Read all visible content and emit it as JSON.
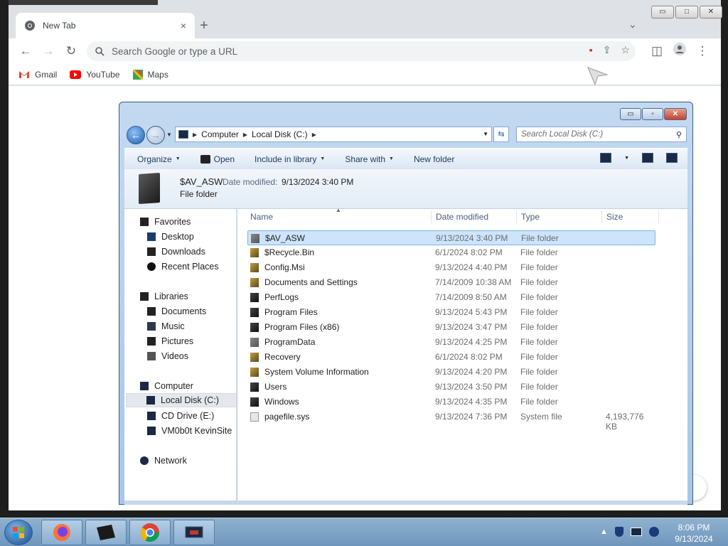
{
  "browser": {
    "tab_title": "New Tab",
    "tab_close": "×",
    "new_tab": "+",
    "omnibox_placeholder": "Search Google or type a URL",
    "bookmarks": [
      {
        "label": "Gmail",
        "color": "#ea4335"
      },
      {
        "label": "YouTube",
        "color": "#ff0000"
      },
      {
        "label": "Maps",
        "color": "#34a853"
      }
    ],
    "win_controls": [
      "▭",
      "□",
      "✕"
    ]
  },
  "explorer": {
    "controls": [
      "▭",
      "▫",
      "✕"
    ],
    "breadcrumb": [
      "Computer",
      "Local Disk (C:)"
    ],
    "search_placeholder": "Search Local Disk (C:)",
    "commands": [
      {
        "label": "Organize",
        "arrow": "▼"
      },
      {
        "label": "Open",
        "arrow": ""
      },
      {
        "label": "Include in library",
        "arrow": "▼"
      },
      {
        "label": "Share with",
        "arrow": "▼"
      },
      {
        "label": "New folder",
        "arrow": ""
      }
    ],
    "details": {
      "name": "$AV_ASW",
      "date_label": "Date modified:",
      "date_value": "9/13/2024 3:40 PM",
      "kind": "File folder"
    },
    "nav": {
      "favorites": "Favorites",
      "desktop": "Desktop",
      "downloads": "Downloads",
      "recent": "Recent Places",
      "libraries": "Libraries",
      "documents": "Documents",
      "music": "Music",
      "pictures": "Pictures",
      "videos": "Videos",
      "computer": "Computer",
      "local_disk": "Local Disk (C:)",
      "cd_drive": "CD Drive (E:)",
      "share": "VM0b0t KevinSite",
      "network": "Network"
    },
    "columns": {
      "name": "Name",
      "date": "Date modified",
      "type": "Type",
      "size": "Size"
    },
    "rows": [
      {
        "name": "$AV_ASW",
        "date": "9/13/2024 3:40 PM",
        "type": "File folder",
        "size": "",
        "icon": "fold-light",
        "selected": true
      },
      {
        "name": "$Recycle.Bin",
        "date": "6/1/2024 8:02 PM",
        "type": "File folder",
        "size": "",
        "icon": "fold-lock"
      },
      {
        "name": "Config.Msi",
        "date": "9/13/2024 4:40 PM",
        "type": "File folder",
        "size": "",
        "icon": "fold-lock"
      },
      {
        "name": "Documents and Settings",
        "date": "7/14/2009 10:38 AM",
        "type": "File folder",
        "size": "",
        "icon": "fold-lock"
      },
      {
        "name": "PerfLogs",
        "date": "7/14/2009 8:50 AM",
        "type": "File folder",
        "size": "",
        "icon": "fold-dark"
      },
      {
        "name": "Program Files",
        "date": "9/13/2024 5:43 PM",
        "type": "File folder",
        "size": "",
        "icon": "fold-dark"
      },
      {
        "name": "Program Files (x86)",
        "date": "9/13/2024 3:47 PM",
        "type": "File folder",
        "size": "",
        "icon": "fold-dark"
      },
      {
        "name": "ProgramData",
        "date": "9/13/2024 4:25 PM",
        "type": "File folder",
        "size": "",
        "icon": "fold-light"
      },
      {
        "name": "Recovery",
        "date": "6/1/2024 8:02 PM",
        "type": "File folder",
        "size": "",
        "icon": "fold-lock"
      },
      {
        "name": "System Volume Information",
        "date": "9/13/2024 4:20 PM",
        "type": "File folder",
        "size": "",
        "icon": "fold-lock"
      },
      {
        "name": "Users",
        "date": "9/13/2024 3:50 PM",
        "type": "File folder",
        "size": "",
        "icon": "fold-dark"
      },
      {
        "name": "Windows",
        "date": "9/13/2024 4:35 PM",
        "type": "File folder",
        "size": "",
        "icon": "fold-dark"
      },
      {
        "name": "pagefile.sys",
        "date": "9/13/2024 7:36 PM",
        "type": "System file",
        "size": "4,193,776 KB",
        "icon": "file-ic"
      }
    ]
  },
  "taskbar": {
    "time": "8:06 PM",
    "date": "9/13/2024",
    "tray_arrow": "▲"
  }
}
